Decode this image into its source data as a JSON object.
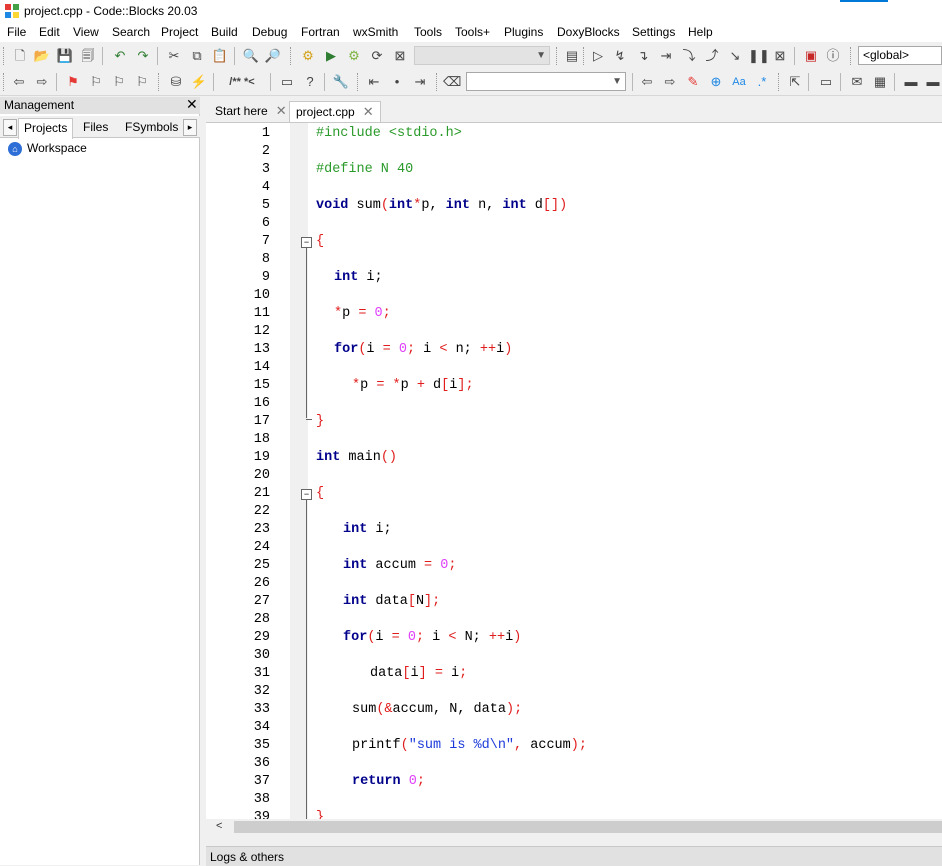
{
  "window": {
    "title": "project.cpp - Code::Blocks 20.03"
  },
  "menu": [
    "File",
    "Edit",
    "View",
    "Search",
    "Project",
    "Build",
    "Debug",
    "Fortran",
    "wxSmith",
    "Tools",
    "Tools+",
    "Plugins",
    "DoxyBlocks",
    "Settings",
    "Help"
  ],
  "toolbar": {
    "scope_combo": "<global>",
    "comment_btn": "/** *<"
  },
  "management": {
    "title": "Management",
    "tabs": [
      "Projects",
      "Files",
      "FSymbols"
    ],
    "workspace_label": "Workspace"
  },
  "editor": {
    "tabs": [
      "Start here",
      "project.cpp"
    ],
    "active_tab": "project.cpp"
  },
  "logs": {
    "label": "Logs & others"
  },
  "code": {
    "line_numbers": [
      "1",
      "2",
      "3",
      "4",
      "5",
      "6",
      "7",
      "8",
      "9",
      "10",
      "11",
      "12",
      "13",
      "14",
      "15",
      "16",
      "17",
      "18",
      "19",
      "20",
      "21",
      "22",
      "23",
      "24",
      "25",
      "26",
      "27",
      "28",
      "29",
      "30",
      "31",
      "32",
      "33",
      "34",
      "35",
      "36",
      "37",
      "38",
      "39"
    ],
    "l1_pp": "#include <stdio.h>",
    "l3_pp": "#define N 40",
    "l5": {
      "kw_void": "void",
      "fn": " sum",
      "p1": "(",
      "kw_int1": "int",
      "star": "*",
      "p": "p, ",
      "kw_int2": "int",
      "n": " n, ",
      "kw_int3": "int",
      "d": " d",
      "br": "[])"
    },
    "l7_brace": "{",
    "l9": {
      "kw": "int",
      "rest": " i;"
    },
    "l11": {
      "star": "*",
      "p": "p ",
      "eq": "=",
      "sp": " ",
      "num": "0",
      "semi": ";"
    },
    "l13": {
      "kw": "for",
      "po": "(",
      "i": "i ",
      "eq": "=",
      "sp": " ",
      "num": "0",
      "semi": ";",
      "cond": " i ",
      "lt": "<",
      "n": " n; ",
      "inc": "++",
      "i2": "i",
      "pc": ")"
    },
    "l15": {
      "star1": "*",
      "p": "p ",
      "eq": "=",
      "sp": " ",
      "star2": "*",
      "p2": "p ",
      "plus": "+",
      "d": " d",
      "bo": "[",
      "i": "i",
      "bc": "]",
      "semi": ";"
    },
    "l17_brace": "}",
    "l19": {
      "kw": "int",
      "fn": " main",
      "paren": "()"
    },
    "l21_brace": "{",
    "l23": {
      "kw": "int",
      "rest": " i;"
    },
    "l25": {
      "kw": "int",
      "rest": " accum ",
      "eq": "=",
      "sp": " ",
      "num": "0",
      "semi": ";"
    },
    "l27": {
      "kw": "int",
      "rest": " data",
      "bo": "[",
      "n": "N",
      "bc": "]",
      "semi": ";"
    },
    "l29": {
      "kw": "for",
      "po": "(",
      "i": "i ",
      "eq": "=",
      "sp": " ",
      "num": "0",
      "semi": ";",
      "cond": " i ",
      "lt": "<",
      "n": " N; ",
      "inc": "++",
      "i2": "i",
      "pc": ")"
    },
    "l31": {
      "d": "data",
      "bo": "[",
      "i": "i",
      "bc": "]",
      "sp": " ",
      "eq": "=",
      "rest": " i",
      "semi": ";"
    },
    "l33": {
      "fn": "sum",
      "po": "(",
      "amp": "&",
      "args": "accum, N, data",
      "pc": ")",
      "semi": ";"
    },
    "l35": {
      "fn": "printf",
      "po": "(",
      "str": "\"sum is %d\\n\"",
      "comma": ",",
      "arg": " accum",
      "pc": ")",
      "semi": ";"
    },
    "l37": {
      "kw": "return",
      "sp": " ",
      "num": "0",
      "semi": ";"
    },
    "l39_brace": "}"
  }
}
